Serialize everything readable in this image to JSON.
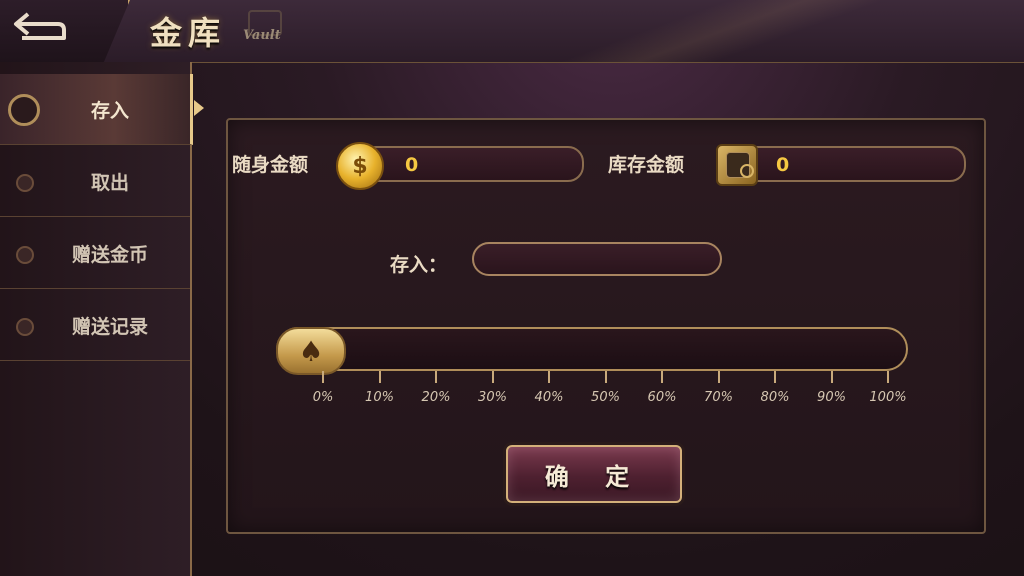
{
  "header": {
    "title": "金库",
    "subtitle": "Vault",
    "back_icon": "back-arrow-icon"
  },
  "sidebar": {
    "items": [
      {
        "label": "存入",
        "active": true
      },
      {
        "label": "取出",
        "active": false
      },
      {
        "label": "赠送金币",
        "active": false
      },
      {
        "label": "赠送记录",
        "active": false
      }
    ]
  },
  "main": {
    "wallet_label": "随身金额",
    "wallet_value": "0",
    "wallet_icon": "coin-stack-icon",
    "vault_label": "库存金额",
    "vault_value": "0",
    "vault_icon": "safe-icon",
    "deposit_label": "存入：",
    "deposit_value": "",
    "slider": {
      "value_percent": 0,
      "thumb_icon": "spade-icon",
      "ticks": [
        "0%",
        "10%",
        "20%",
        "30%",
        "40%",
        "50%",
        "60%",
        "70%",
        "80%",
        "90%",
        "100%"
      ]
    },
    "confirm_label": "确 定"
  },
  "colors": {
    "accent_gold": "#e7c98a",
    "value_yellow": "#f5c842",
    "background": "#1e1318"
  }
}
